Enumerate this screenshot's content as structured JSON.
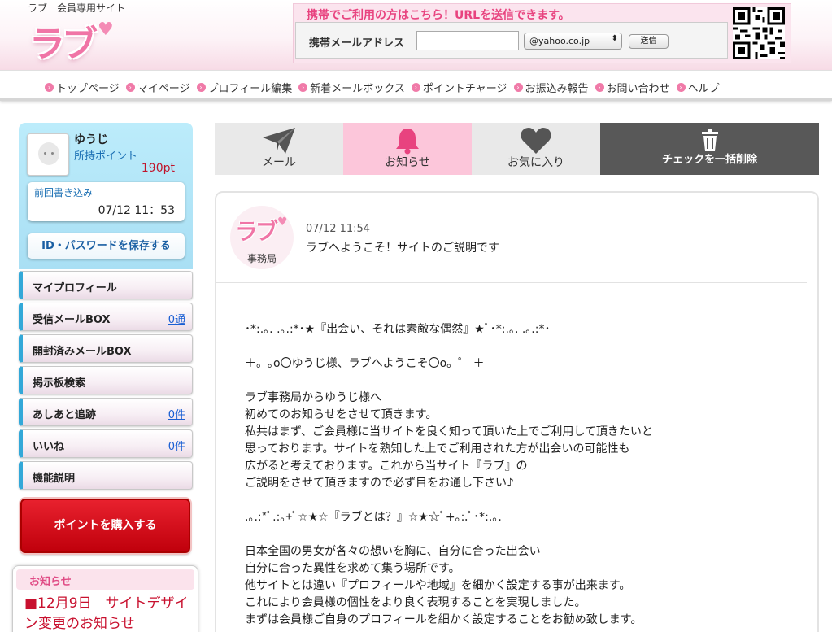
{
  "header": {
    "site_subtitle": "ラブ　会員専用サイト",
    "logo_text": "ラブ",
    "mobile": {
      "title": "携帯でご利用の方はこちら！URLを送信できます。",
      "email_label": "携帯メールアドレス",
      "email_value": "",
      "domain_selected": "@yahoo.co.jp",
      "send_label": "送信"
    }
  },
  "nav": {
    "items": [
      "トップページ",
      "マイページ",
      "プロフィール編集",
      "新着メールボックス",
      "ポイントチャージ",
      "お振込み報告",
      "お問い合わせ",
      "ヘルプ"
    ]
  },
  "profile": {
    "name": "ゆうじ",
    "points_label": "所持ポイント",
    "points_value": "190pt",
    "last_post_label": "前回書き込み",
    "last_post_time": "07/12 11：53",
    "save_id_label": "ID・パスワードを保存する"
  },
  "menu": {
    "items": [
      {
        "label": "マイプロフィール",
        "count": ""
      },
      {
        "label": "受信メールBOX",
        "count": "0通"
      },
      {
        "label": "開封済みメールBOX",
        "count": ""
      },
      {
        "label": "掲示板検索",
        "count": ""
      },
      {
        "label": "あしあと追跡",
        "count": "0件"
      },
      {
        "label": "いいね",
        "count": "0件"
      },
      {
        "label": "機能説明",
        "count": ""
      }
    ]
  },
  "buy_button_label": "ポイントを購入する",
  "notice": {
    "title": "お知らせ",
    "text": "■12月9日　サイトデザイン変更のお知らせ"
  },
  "tabs": {
    "mail": "メール",
    "notice": "お知らせ",
    "favorite": "お気に入り",
    "delete": "チェックを一括削除"
  },
  "colors": {
    "accent_pink": "#f075a6",
    "tab_active": "#fcc6da",
    "sidebar_blue": "#bcecfb",
    "buy_red": "#d40f1c",
    "link_blue": "#1a5fd3"
  },
  "message": {
    "sender_logo": "ラブ",
    "sender_label": "事務局",
    "date": "07/12 11:54",
    "subject": "ラブへようこそ！サイトのご説明です",
    "body": "･*:.｡. .｡.:*･★『出会い、それは素敵な偶然』★ﾟ･*:.｡. .｡.:*･\n\n＋。｡o〇ゆうじ様、ラブへようこそ〇o。゜ ＋\n\nラブ事務局からゆうじ様へ\n初めてのお知らせをさせて頂きます。\n私共はまず、ご会員様に当サイトを良く知って頂いた上でご利用して頂きたいと\n思っております。サイトを熟知した上でご利用された方が出会いの可能性も\n広がると考えております。これから当サイト『ラブ』の\nご説明をさせて頂きますので必ず目をお通し下さい♪\n\n.｡.:*ﾟ.:｡+ﾟ☆★☆『ラブとは？』☆★☆ﾟ+｡:.ﾟ･*:.｡.\n\n日本全国の男女が各々の想いを胸に、自分に合った出会い\n自分に合った異性を求めて集う場所です。\n他サイトとは違い『プロフィールや地域』を細かく設定する事が出来ます。\nこれにより会員様の個性をより良く表現することを実現しました。\nまずは会員様ご自身のプロフィールを細かく設定することをお勧め致します。"
  }
}
